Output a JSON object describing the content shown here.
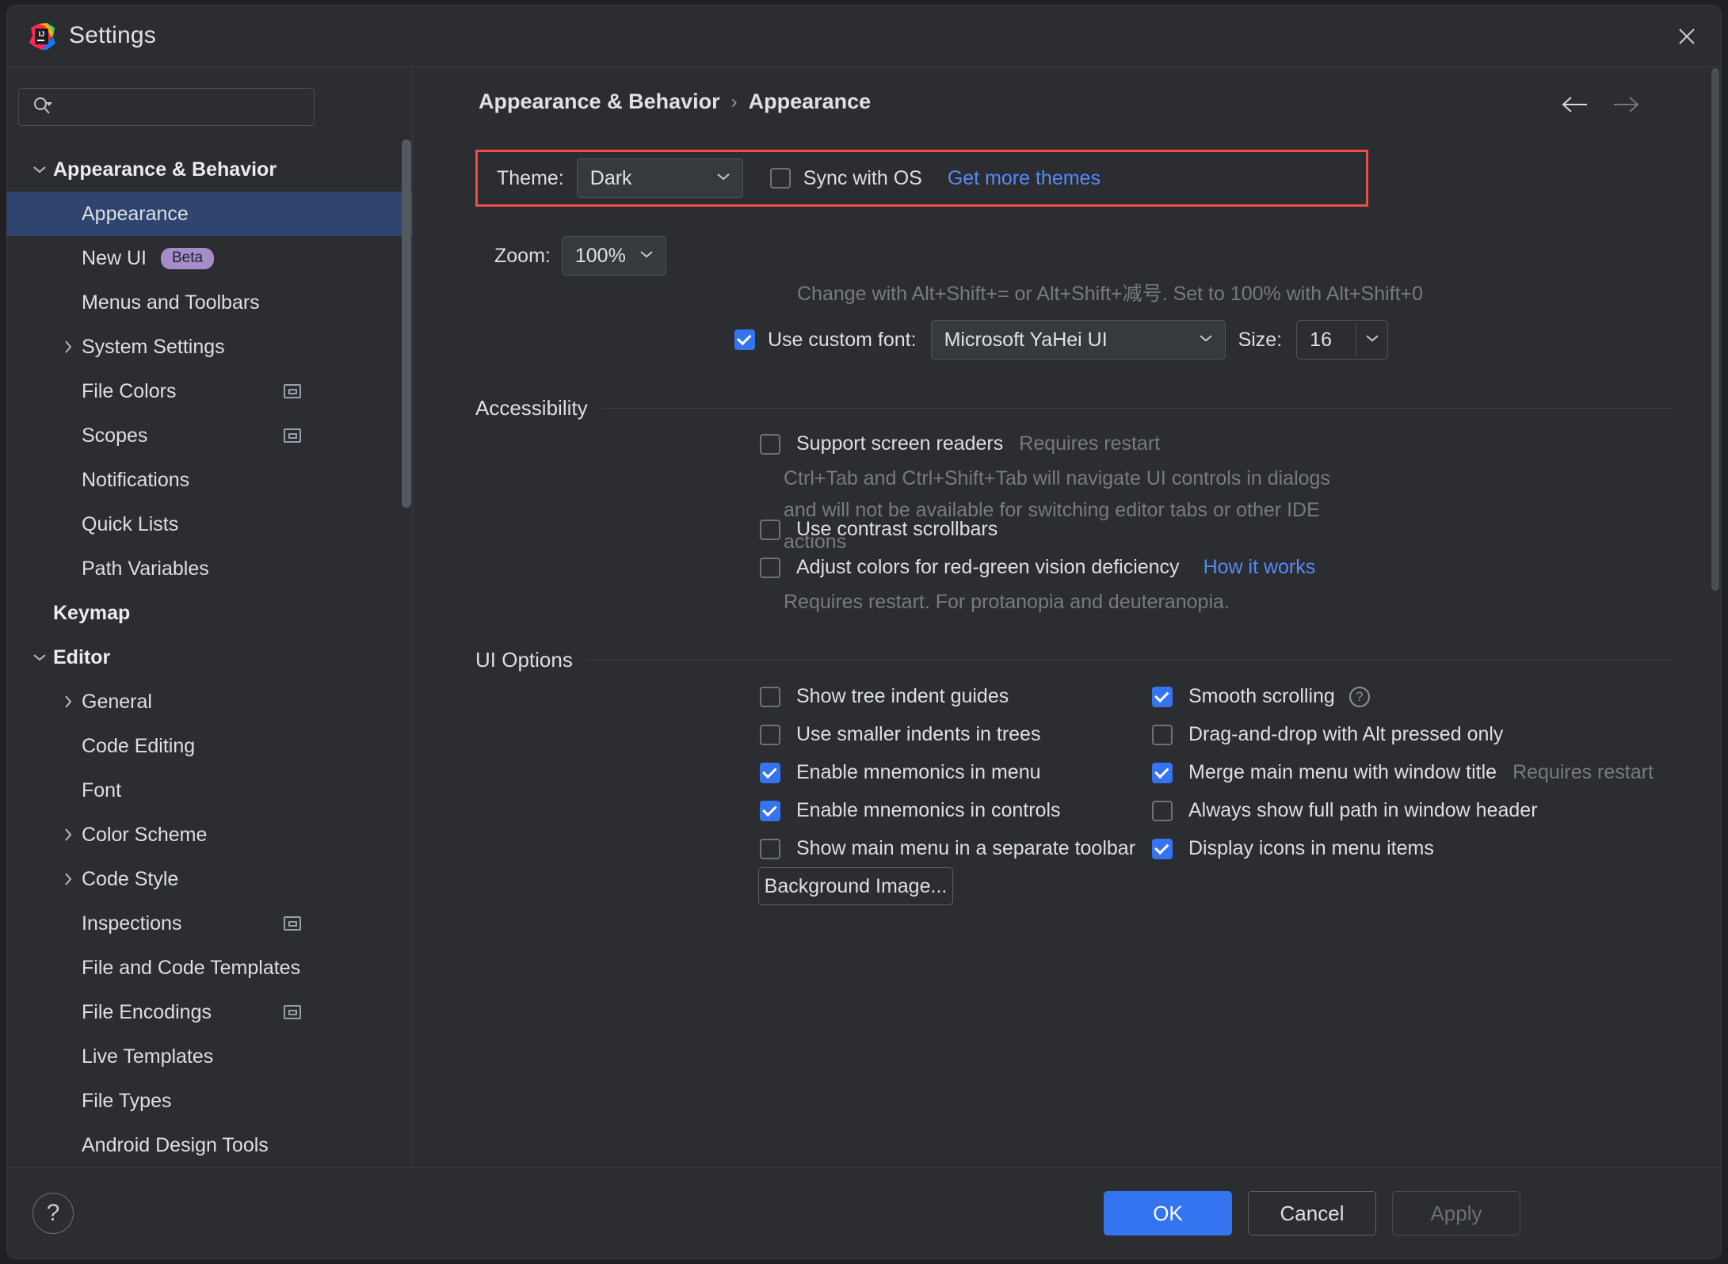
{
  "window": {
    "title": "Settings",
    "logo_icon": "intellij-idea-logo",
    "close_icon": "close-icon"
  },
  "sidebar": {
    "search": {
      "placeholder": "",
      "value": "",
      "icon": "search-icon",
      "dropdown_icon": "chevron-down-icon"
    },
    "items": [
      {
        "label": "Appearance & Behavior",
        "level": 0,
        "group": true,
        "twisty": "chevron-down-icon",
        "selected": false,
        "badge": null,
        "trailing_icon": null
      },
      {
        "label": "Appearance",
        "level": 1,
        "group": false,
        "twisty": null,
        "selected": true,
        "badge": null,
        "trailing_icon": null
      },
      {
        "label": "New UI",
        "level": 1,
        "group": false,
        "twisty": null,
        "selected": false,
        "badge": "Beta",
        "trailing_icon": null
      },
      {
        "label": "Menus and Toolbars",
        "level": 1,
        "group": false,
        "twisty": null,
        "selected": false,
        "badge": null,
        "trailing_icon": null
      },
      {
        "label": "System Settings",
        "level": 1,
        "group": false,
        "twisty": "chevron-right-icon",
        "selected": false,
        "badge": null,
        "trailing_icon": null
      },
      {
        "label": "File Colors",
        "level": 1,
        "group": false,
        "twisty": null,
        "selected": false,
        "badge": null,
        "trailing_icon": "project-scope-icon"
      },
      {
        "label": "Scopes",
        "level": 1,
        "group": false,
        "twisty": null,
        "selected": false,
        "badge": null,
        "trailing_icon": "project-scope-icon"
      },
      {
        "label": "Notifications",
        "level": 1,
        "group": false,
        "twisty": null,
        "selected": false,
        "badge": null,
        "trailing_icon": null
      },
      {
        "label": "Quick Lists",
        "level": 1,
        "group": false,
        "twisty": null,
        "selected": false,
        "badge": null,
        "trailing_icon": null
      },
      {
        "label": "Path Variables",
        "level": 1,
        "group": false,
        "twisty": null,
        "selected": false,
        "badge": null,
        "trailing_icon": null
      },
      {
        "label": "Keymap",
        "level": 0,
        "group": true,
        "twisty": null,
        "selected": false,
        "badge": null,
        "trailing_icon": null
      },
      {
        "label": "Editor",
        "level": 0,
        "group": true,
        "twisty": "chevron-down-icon",
        "selected": false,
        "badge": null,
        "trailing_icon": null
      },
      {
        "label": "General",
        "level": 1,
        "group": false,
        "twisty": "chevron-right-icon",
        "selected": false,
        "badge": null,
        "trailing_icon": null
      },
      {
        "label": "Code Editing",
        "level": 1,
        "group": false,
        "twisty": null,
        "selected": false,
        "badge": null,
        "trailing_icon": null
      },
      {
        "label": "Font",
        "level": 1,
        "group": false,
        "twisty": null,
        "selected": false,
        "badge": null,
        "trailing_icon": null
      },
      {
        "label": "Color Scheme",
        "level": 1,
        "group": false,
        "twisty": "chevron-right-icon",
        "selected": false,
        "badge": null,
        "trailing_icon": null
      },
      {
        "label": "Code Style",
        "level": 1,
        "group": false,
        "twisty": "chevron-right-icon",
        "selected": false,
        "badge": null,
        "trailing_icon": null
      },
      {
        "label": "Inspections",
        "level": 1,
        "group": false,
        "twisty": null,
        "selected": false,
        "badge": null,
        "trailing_icon": "project-scope-icon"
      },
      {
        "label": "File and Code Templates",
        "level": 1,
        "group": false,
        "twisty": null,
        "selected": false,
        "badge": null,
        "trailing_icon": null
      },
      {
        "label": "File Encodings",
        "level": 1,
        "group": false,
        "twisty": null,
        "selected": false,
        "badge": null,
        "trailing_icon": "project-scope-icon"
      },
      {
        "label": "Live Templates",
        "level": 1,
        "group": false,
        "twisty": null,
        "selected": false,
        "badge": null,
        "trailing_icon": null
      },
      {
        "label": "File Types",
        "level": 1,
        "group": false,
        "twisty": null,
        "selected": false,
        "badge": null,
        "trailing_icon": null
      },
      {
        "label": "Android Design Tools",
        "level": 1,
        "group": false,
        "twisty": null,
        "selected": false,
        "badge": null,
        "trailing_icon": null
      }
    ]
  },
  "main": {
    "breadcrumb": {
      "root": "Appearance & Behavior",
      "separator": "›",
      "leaf": "Appearance"
    },
    "nav": {
      "back_icon": "arrow-left-icon",
      "forward_icon": "arrow-right-icon"
    },
    "theme": {
      "label": "Theme:",
      "value": "Dark",
      "sync_with_os_label": "Sync with OS",
      "sync_with_os_checked": false,
      "get_more_themes_label": "Get more themes",
      "highlight_color": "#f24b4b"
    },
    "zoom": {
      "label": "Zoom:",
      "value": "100%",
      "hint": "Change with Alt+Shift+= or Alt+Shift+减号. Set to 100% with Alt+Shift+0"
    },
    "custom_font": {
      "label": "Use custom font:",
      "checked": true,
      "font_value": "Microsoft YaHei UI",
      "size_label": "Size:",
      "size_value": "16"
    },
    "accessibility": {
      "title": "Accessibility",
      "support_screen_readers": {
        "label": "Support screen readers",
        "checked": false,
        "hint": "Requires restart",
        "description": "Ctrl+Tab and Ctrl+Shift+Tab will navigate UI controls in dialogs and will not be available for switching editor tabs or other IDE actions"
      },
      "use_contrast_scrollbars": {
        "label": "Use contrast scrollbars",
        "checked": false
      },
      "adjust_colors": {
        "label": "Adjust colors for red-green vision deficiency",
        "checked": false,
        "link": "How it works",
        "description": "Requires restart. For protanopia and deuteranopia."
      }
    },
    "ui_options": {
      "title": "UI Options",
      "left_column": [
        {
          "label": "Show tree indent guides",
          "checked": false
        },
        {
          "label": "Use smaller indents in trees",
          "checked": false
        },
        {
          "label": "Enable mnemonics in menu",
          "checked": true
        },
        {
          "label": "Enable mnemonics in controls",
          "checked": true
        },
        {
          "label": "Show main menu in a separate toolbar",
          "checked": false
        }
      ],
      "right_column": [
        {
          "label": "Smooth scrolling",
          "checked": true,
          "help_icon": "question-circle-icon",
          "hint": null
        },
        {
          "label": "Drag-and-drop with Alt pressed only",
          "checked": false,
          "help_icon": null,
          "hint": null
        },
        {
          "label": "Merge main menu with window title",
          "checked": true,
          "help_icon": null,
          "hint": "Requires restart"
        },
        {
          "label": "Always show full path in window header",
          "checked": false,
          "help_icon": null,
          "hint": null
        },
        {
          "label": "Display icons in menu items",
          "checked": true,
          "help_icon": null,
          "hint": null
        }
      ],
      "background_image_button": "Background Image..."
    }
  },
  "footer": {
    "help_label": "?",
    "ok_label": "OK",
    "cancel_label": "Cancel",
    "apply_label": "Apply",
    "accent_color": "#3574f0"
  }
}
